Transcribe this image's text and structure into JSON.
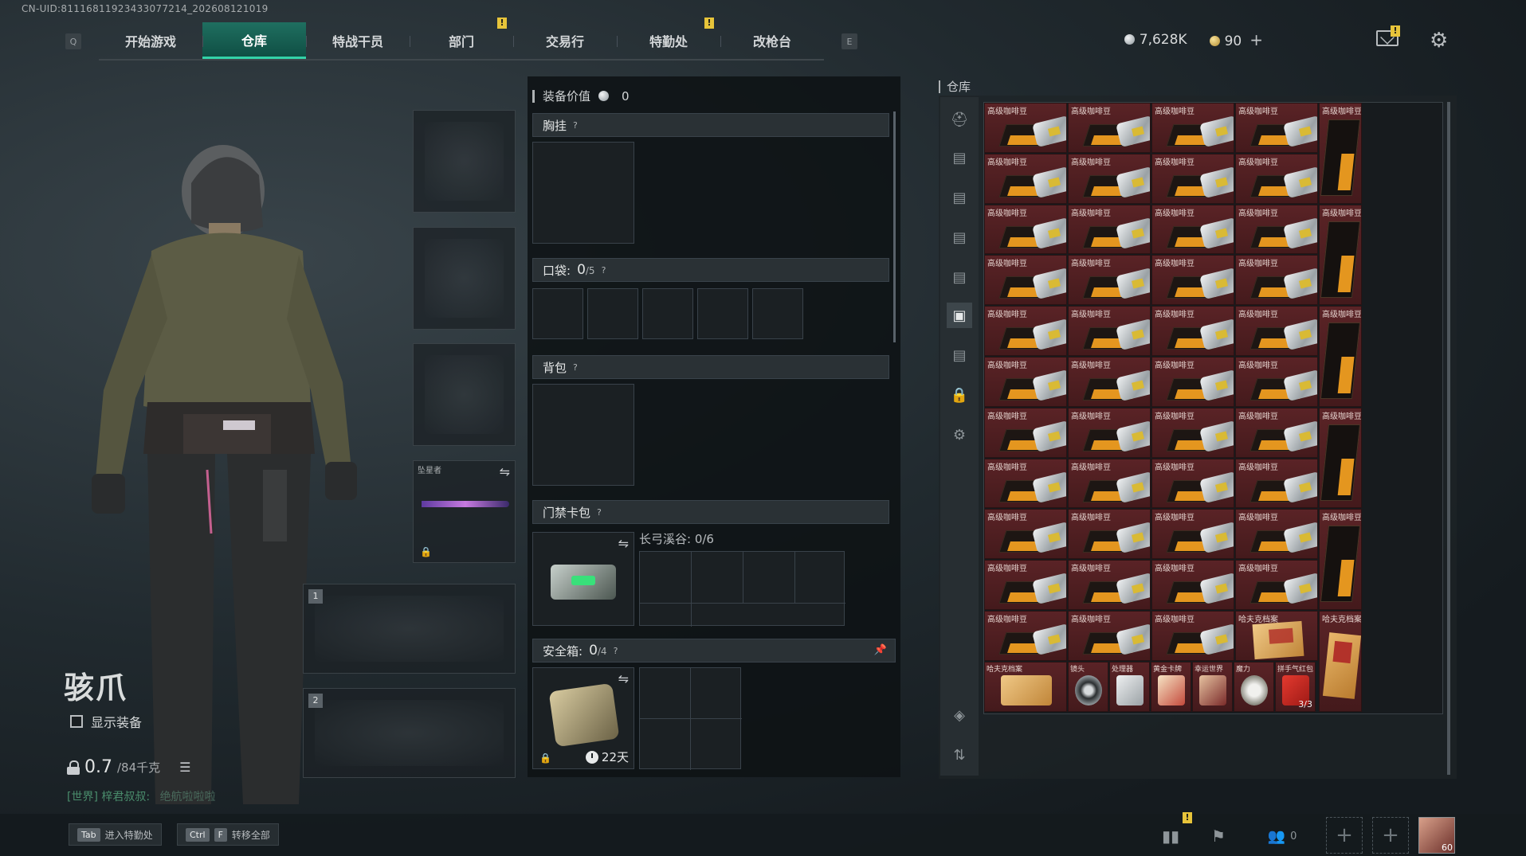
{
  "uid": "CN-UID:8111681192343307​7214_202608121019",
  "nav": {
    "left_key": "Q",
    "right_key": "E",
    "tabs": [
      {
        "label": "开始游戏",
        "active": false,
        "warn": false
      },
      {
        "label": "仓库",
        "active": true,
        "warn": false
      },
      {
        "label": "特战干员",
        "active": false,
        "warn": false
      },
      {
        "label": "部门",
        "active": false,
        "warn": true
      },
      {
        "label": "交易行",
        "active": false,
        "warn": false
      },
      {
        "label": "特勤处",
        "active": false,
        "warn": true
      },
      {
        "label": "改枪台",
        "active": false,
        "warn": false
      }
    ],
    "warn_mark": "!"
  },
  "currency": {
    "silver": "7,628K",
    "gold": "90",
    "plus": "+"
  },
  "character": {
    "name": "骇爪",
    "show_equipment_label": "显示装备",
    "weight_value": "0.7",
    "weight_max": "/84千克",
    "chat_channel": "[世界]",
    "chat_sender": "梓君叔叔:",
    "chat_text": "绝航啦啦啦"
  },
  "gear_slots": {
    "melee_label": "坠星者",
    "primary_num": "1",
    "secondary_num": "2"
  },
  "equipment": {
    "value_label": "装备价值",
    "value": "0",
    "chest_rig": "胸挂",
    "pockets_label": "口袋:",
    "pockets_count": "0",
    "pockets_max": "/5",
    "backpack": "背包",
    "keycard_label": "门禁卡包",
    "keycard_map": "长弓溪谷: 0/6",
    "safe_label": "安全箱:",
    "safe_count": "0",
    "safe_max": "/4",
    "safe_days": "22天",
    "help_mark": "?"
  },
  "warehouse": {
    "title": "仓库",
    "item_name_coffee": "高级咖啡豆",
    "item_name_file": "哈夫克档案",
    "last_row": [
      {
        "name": "哈夫克档案",
        "kind": "file-wide"
      },
      {
        "name": "镜头",
        "kind": "lens"
      },
      {
        "name": "处理器",
        "kind": "device"
      },
      {
        "name": "黄金卡牌",
        "kind": "card"
      },
      {
        "name": "幸运世界",
        "kind": "poster"
      },
      {
        "name": "魔力",
        "kind": "orb"
      },
      {
        "name": "拼手气红包",
        "kind": "redpack",
        "count": "3/3"
      }
    ]
  },
  "hotkeys": {
    "tab_key": "Tab",
    "tab_label": "进入特勤处",
    "ctrl_key": "Ctrl",
    "f_key": "F",
    "transfer_label": "转移全部"
  },
  "bottom_right": {
    "friends_count": "0",
    "avatar_level": "60"
  },
  "colors": {
    "accent": "#33d3a8",
    "item_bg": "#4f1f22",
    "warning": "#e7c43a"
  }
}
